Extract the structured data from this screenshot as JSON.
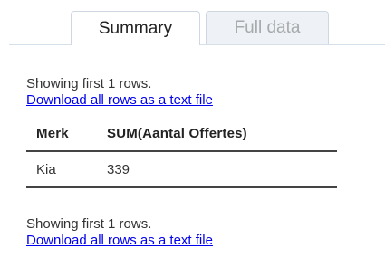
{
  "tabs": {
    "summary_label": "Summary",
    "full_data_label": "Full data"
  },
  "top": {
    "showing_text": "Showing first 1 rows.",
    "download_link": "Download all rows as a text file"
  },
  "table": {
    "columns": [
      "Merk",
      "SUM(Aantal Offertes)"
    ],
    "rows": [
      [
        "Kia",
        "339"
      ]
    ]
  },
  "bottom": {
    "showing_text": "Showing first 1 rows.",
    "download_link": "Download all rows as a text file"
  }
}
